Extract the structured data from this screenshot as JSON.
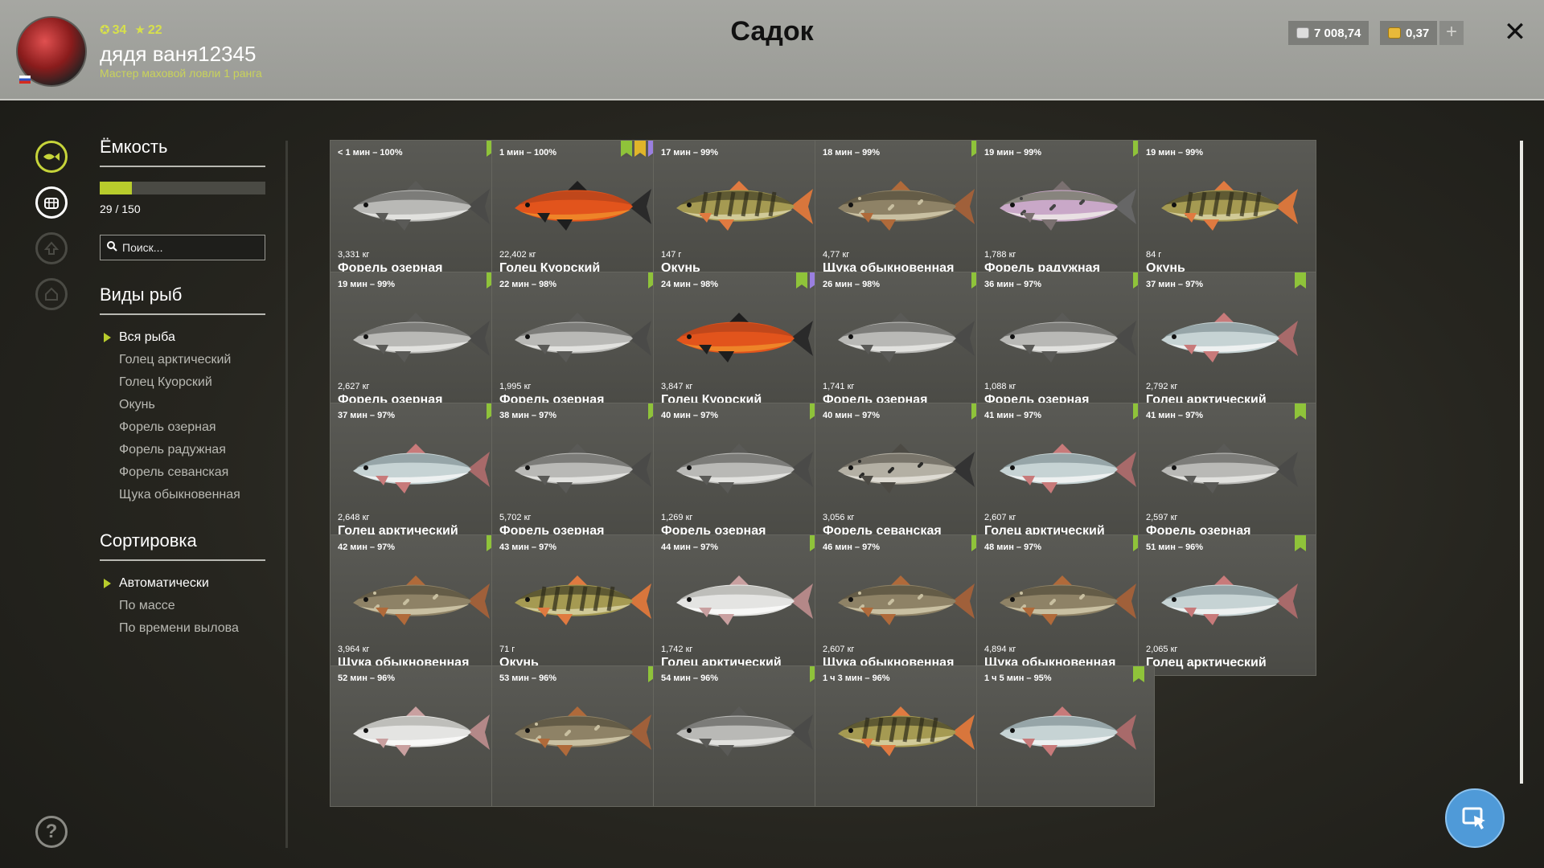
{
  "header": {
    "title": "Садок",
    "player": {
      "level": "34",
      "stars": "22",
      "name": "дядя ваня12345",
      "rank": "Мастер маховой ловли 1 ранга"
    },
    "currency_silver": "7 008,74",
    "currency_gold": "0,37",
    "add_label": "+",
    "close_label": "✕"
  },
  "sidebar": {
    "capacity_title": "Ёмкость",
    "capacity_text": "29 / 150",
    "capacity_fraction": 0.193,
    "search_placeholder": "Поиск...",
    "species_title": "Виды рыб",
    "species": [
      "Вся рыба",
      "Голец арктический",
      "Голец Куорский",
      "Окунь",
      "Форель озерная",
      "Форель радужная",
      "Форель севанская",
      "Щука обыкновенная"
    ],
    "sort_title": "Сортировка",
    "sort": [
      "Автоматически",
      "По массе",
      "По времени вылова"
    ]
  },
  "fish": [
    {
      "time": "< 1 мин – 100%",
      "weight": "3,331 кг",
      "name": "Форель озерная",
      "tags": [
        "green"
      ],
      "kind": "trout"
    },
    {
      "time": "1 мин – 100%",
      "weight": "22,402 кг",
      "name": "Голец Куорский",
      "tags": [
        "green",
        "yellow",
        "purple"
      ],
      "kind": "char-red"
    },
    {
      "time": "17 мин – 99%",
      "weight": "147 г",
      "name": "Окунь",
      "tags": [],
      "kind": "perch"
    },
    {
      "time": "18 мин – 99%",
      "weight": "4,77 кг",
      "name": "Щука обыкновенная",
      "tags": [
        "green"
      ],
      "kind": "pike"
    },
    {
      "time": "19 мин – 99%",
      "weight": "1,788 кг",
      "name": "Форель радужная",
      "tags": [
        "green"
      ],
      "kind": "rainbow"
    },
    {
      "time": "19 мин – 99%",
      "weight": "84 г",
      "name": "Окунь",
      "tags": [],
      "kind": "perch"
    },
    {
      "time": "19 мин – 99%",
      "weight": "2,627 кг",
      "name": "Форель озерная",
      "tags": [
        "green"
      ],
      "kind": "trout"
    },
    {
      "time": "22 мин – 98%",
      "weight": "1,995 кг",
      "name": "Форель озерная",
      "tags": [
        "green"
      ],
      "kind": "trout"
    },
    {
      "time": "24 мин – 98%",
      "weight": "3,847 кг",
      "name": "Голец Куорский",
      "tags": [
        "green",
        "purple"
      ],
      "kind": "char-red"
    },
    {
      "time": "26 мин – 98%",
      "weight": "1,741 кг",
      "name": "Форель озерная",
      "tags": [
        "green"
      ],
      "kind": "trout"
    },
    {
      "time": "36 мин – 97%",
      "weight": "1,088 кг",
      "name": "Форель озерная",
      "tags": [
        "green"
      ],
      "kind": "trout"
    },
    {
      "time": "37 мин – 97%",
      "weight": "2,792 кг",
      "name": "Голец арктический",
      "tags": [
        "green"
      ],
      "kind": "arctic"
    },
    {
      "time": "37 мин – 97%",
      "weight": "2,648 кг",
      "name": "Голец арктический",
      "tags": [
        "green"
      ],
      "kind": "arctic"
    },
    {
      "time": "38 мин – 97%",
      "weight": "5,702 кг",
      "name": "Форель озерная",
      "tags": [
        "green"
      ],
      "kind": "trout"
    },
    {
      "time": "40 мин – 97%",
      "weight": "1,269 кг",
      "name": "Форель озерная",
      "tags": [
        "green"
      ],
      "kind": "trout"
    },
    {
      "time": "40 мин – 97%",
      "weight": "3,056 кг",
      "name": "Форель севанская",
      "tags": [
        "green"
      ],
      "kind": "sevan"
    },
    {
      "time": "41 мин – 97%",
      "weight": "2,607 кг",
      "name": "Голец арктический",
      "tags": [
        "green"
      ],
      "kind": "arctic"
    },
    {
      "time": "41 мин – 97%",
      "weight": "2,597 кг",
      "name": "Форель озерная",
      "tags": [
        "green"
      ],
      "kind": "trout"
    },
    {
      "time": "42 мин – 97%",
      "weight": "3,964 кг",
      "name": "Щука обыкновенная",
      "tags": [
        "green"
      ],
      "kind": "pike"
    },
    {
      "time": "43 мин – 97%",
      "weight": "71 г",
      "name": "Окунь",
      "tags": [],
      "kind": "perch"
    },
    {
      "time": "44 мин – 97%",
      "weight": "1,742 кг",
      "name": "Голец арктический",
      "tags": [
        "green"
      ],
      "kind": "arctic-white"
    },
    {
      "time": "46 мин – 97%",
      "weight": "2,607 кг",
      "name": "Щука обыкновенная",
      "tags": [
        "green"
      ],
      "kind": "pike"
    },
    {
      "time": "48 мин – 97%",
      "weight": "4,894 кг",
      "name": "Щука обыкновенная",
      "tags": [
        "green"
      ],
      "kind": "pike"
    },
    {
      "time": "51 мин – 96%",
      "weight": "2,065 кг",
      "name": "Голец арктический",
      "tags": [
        "green"
      ],
      "kind": "arctic"
    },
    {
      "time": "52 мин – 96%",
      "weight": "",
      "name": "",
      "tags": [],
      "kind": "arctic-white"
    },
    {
      "time": "53 мин – 96%",
      "weight": "",
      "name": "",
      "tags": [
        "green"
      ],
      "kind": "pike"
    },
    {
      "time": "54 мин – 96%",
      "weight": "",
      "name": "",
      "tags": [
        "green"
      ],
      "kind": "trout"
    },
    {
      "time": "1 ч 3 мин – 96%",
      "weight": "",
      "name": "",
      "tags": [],
      "kind": "perch"
    },
    {
      "time": "1 ч 5 мин – 95%",
      "weight": "",
      "name": "",
      "tags": [
        "green"
      ],
      "kind": "arctic"
    }
  ],
  "colors": {
    "accent": "#b8cc2c",
    "tag_green": "#8fc33a",
    "tag_yellow": "#e0b52a",
    "tag_purple": "#9a7fe0",
    "float_button": "#4f9ad8"
  },
  "icons": {
    "rail": [
      "fish-icon",
      "keepnet-icon",
      "level-up-icon",
      "home-icon"
    ],
    "help": "question-icon",
    "float": "cursor-icon"
  }
}
